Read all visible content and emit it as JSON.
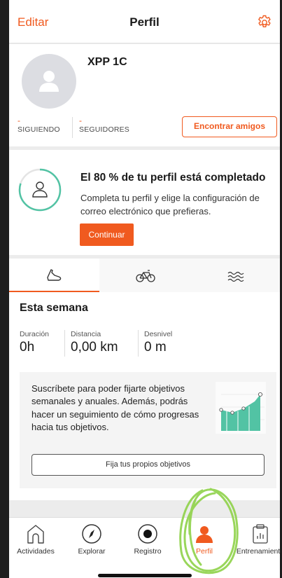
{
  "topbar": {
    "edit_label": "Editar",
    "title": "Perfil",
    "settings_icon": "gear-icon"
  },
  "profile": {
    "username": "XPP 1C",
    "following": {
      "value": "-",
      "label": "SIGUIENDO"
    },
    "followers": {
      "value": "-",
      "label": "SEGUIDORES"
    },
    "find_friends_label": "Encontrar amigos"
  },
  "completion": {
    "percent": 80,
    "headline": "El 80 % de tu perfil está completado",
    "body": "Completa tu perfil y elige la configuración de correo electrónico que prefieras.",
    "button_label": "Continuar"
  },
  "activity_tabs": [
    {
      "icon": "shoe-icon",
      "active": true
    },
    {
      "icon": "bike-icon",
      "active": false
    },
    {
      "icon": "swim-icon",
      "active": false
    }
  ],
  "week": {
    "title": "Esta semana",
    "duration": {
      "label": "Duración",
      "value": "0h"
    },
    "distance": {
      "label": "Distancia",
      "value": "0,00 km"
    },
    "elevation": {
      "label": "Desnivel",
      "value": "0 m"
    }
  },
  "goals": {
    "text": "Suscríbete para poder fijarte objetivos semanales y anuales. Además, podrás hacer un seguimiento de cómo progresas hacia tus objetivos.",
    "button_label": "Fija tus propios objetivos"
  },
  "bottom_nav": {
    "items": [
      {
        "label": "Actividades",
        "icon": "home-icon",
        "active": false
      },
      {
        "label": "Explorar",
        "icon": "compass-icon",
        "active": false
      },
      {
        "label": "Registro",
        "icon": "record-icon",
        "active": false
      },
      {
        "label": "Perfil",
        "icon": "profile-icon",
        "active": true
      },
      {
        "label": "Entrenamiento",
        "icon": "clipboard-chart-icon",
        "active": false
      }
    ]
  },
  "colors": {
    "accent": "#f05a1f",
    "progress_ring": "#52c3a4",
    "graph_fill": "#52c3a4",
    "scribble": "#8fd24a"
  }
}
